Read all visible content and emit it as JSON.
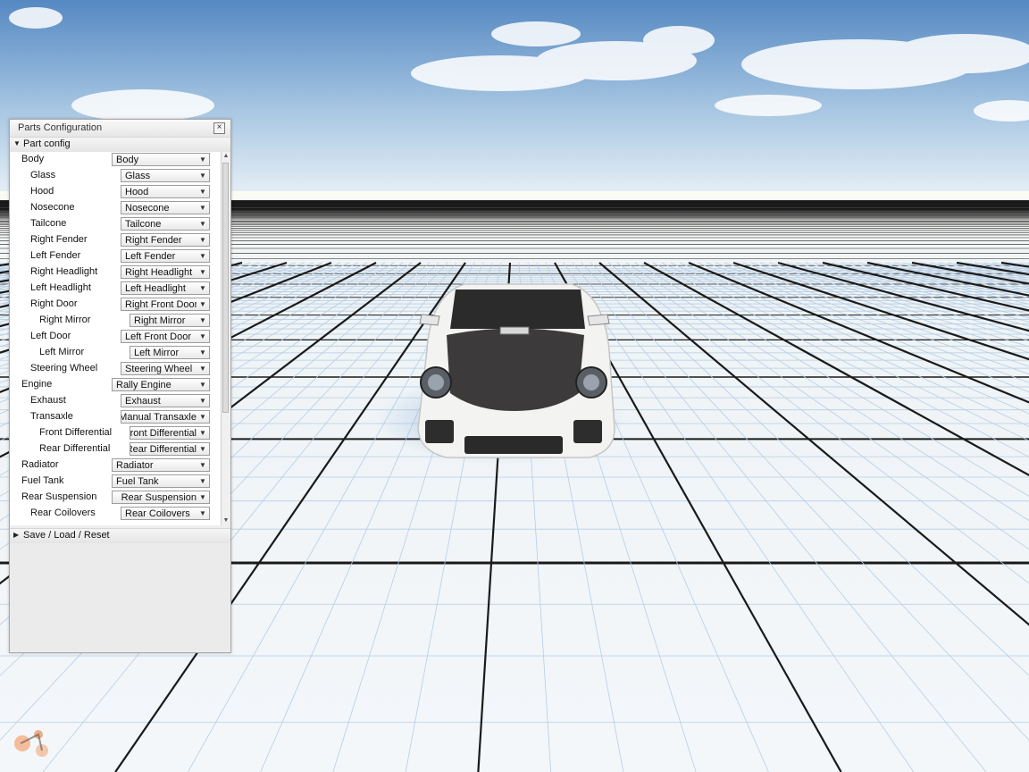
{
  "window": {
    "title": "Parts Configuration",
    "close_label": "×"
  },
  "sections": {
    "part_config": "Part config",
    "save_load_reset": "Save / Load / Reset"
  },
  "parts": [
    {
      "label": "Body",
      "value": "Body",
      "level": 0
    },
    {
      "label": "Glass",
      "value": "Glass",
      "level": 1
    },
    {
      "label": "Hood",
      "value": "Hood",
      "level": 1
    },
    {
      "label": "Nosecone",
      "value": "Nosecone",
      "level": 1
    },
    {
      "label": "Tailcone",
      "value": "Tailcone",
      "level": 1
    },
    {
      "label": "Right Fender",
      "value": "Right Fender",
      "level": 1
    },
    {
      "label": "Left Fender",
      "value": "Left Fender",
      "level": 1
    },
    {
      "label": "Right Headlight",
      "value": "Right Headlight",
      "level": 1
    },
    {
      "label": "Left Headlight",
      "value": "Left Headlight",
      "level": 1
    },
    {
      "label": "Right Door",
      "value": "Right Front Door",
      "level": 1
    },
    {
      "label": "Right Mirror",
      "value": "Right Mirror",
      "level": 2
    },
    {
      "label": "Left Door",
      "value": "Left Front Door",
      "level": 1
    },
    {
      "label": "Left Mirror",
      "value": "Left Mirror",
      "level": 2
    },
    {
      "label": "Steering Wheel",
      "value": "Steering Wheel",
      "level": 1
    },
    {
      "label": "Engine",
      "value": "Rally Engine",
      "level": 0
    },
    {
      "label": "Exhaust",
      "value": "Exhaust",
      "level": 1
    },
    {
      "label": "Transaxle",
      "value": "Manual Transaxle",
      "level": 1,
      "clipped": true
    },
    {
      "label": "Front Differential",
      "value": "Front Differential",
      "level": 2,
      "clipped": true
    },
    {
      "label": "Rear Differential",
      "value": "Rear Differential",
      "level": 2,
      "clipped": true
    },
    {
      "label": "Radiator",
      "value": "Radiator",
      "level": 0
    },
    {
      "label": "Fuel Tank",
      "value": "Fuel Tank",
      "level": 0
    },
    {
      "label": "Rear Suspension",
      "value": "Rear Suspension",
      "level": 0,
      "clipped": true
    },
    {
      "label": "Rear Coilovers",
      "value": "Rear Coilovers",
      "level": 1
    }
  ],
  "icons": {
    "collapse": "triangle-down-icon",
    "expand": "triangle-right-icon",
    "dropdown": "chevron-down-icon"
  },
  "colors": {
    "sky_top": "#5d94c8",
    "sky_horizon": "#e8f0f6",
    "ground": "#f2f6f8",
    "grid_minor": "#b7cfe6",
    "grid_major": "#111111",
    "car_body": "#f4f4f2",
    "car_hood": "#3a3838",
    "logo": "#f0a070"
  }
}
